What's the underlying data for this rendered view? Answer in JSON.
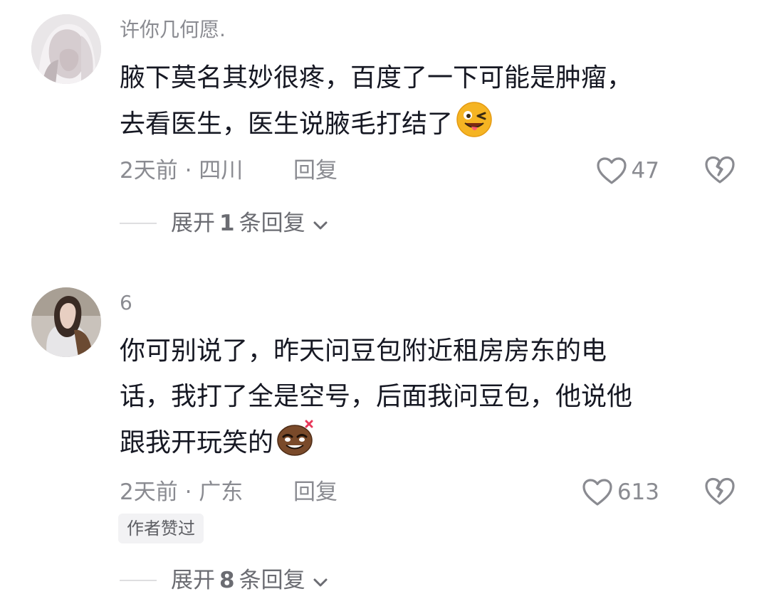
{
  "comments": [
    {
      "username": "许你几何愿.",
      "lines": [
        "腋下莫名其妙很疼，百度了一下可能是肿瘤，",
        "去看医生，医生说腋毛打结了"
      ],
      "emoji": "wink-tongue-emoji",
      "time_location": "2天前 · 四川",
      "reply_label": "回复",
      "like_count": "47",
      "expand": {
        "prefix": "展开",
        "count": "1",
        "suffix": "条回复"
      }
    },
    {
      "username": "6",
      "lines": [
        "你可别说了，昨天问豆包附近租房房东的电",
        "话，我打了全是空号，后面我问豆包，他说他",
        "跟我开玩笑的"
      ],
      "emoji": "smug-bean-emoji",
      "time_location": "2天前 · 广东",
      "reply_label": "回复",
      "like_count": "613",
      "author_badge": "作者赞过",
      "expand": {
        "prefix": "展开",
        "count": "8",
        "suffix": "条回复"
      }
    }
  ],
  "icons": {
    "like": "heart-outline-icon",
    "dislike": "broken-heart-icon",
    "expand": "chevron-down-icon"
  },
  "colors": {
    "text": "#161823",
    "muted": "#8a8b91",
    "emoji_yellow": "#f5b423",
    "emoji_brown": "#7a4a2a"
  }
}
